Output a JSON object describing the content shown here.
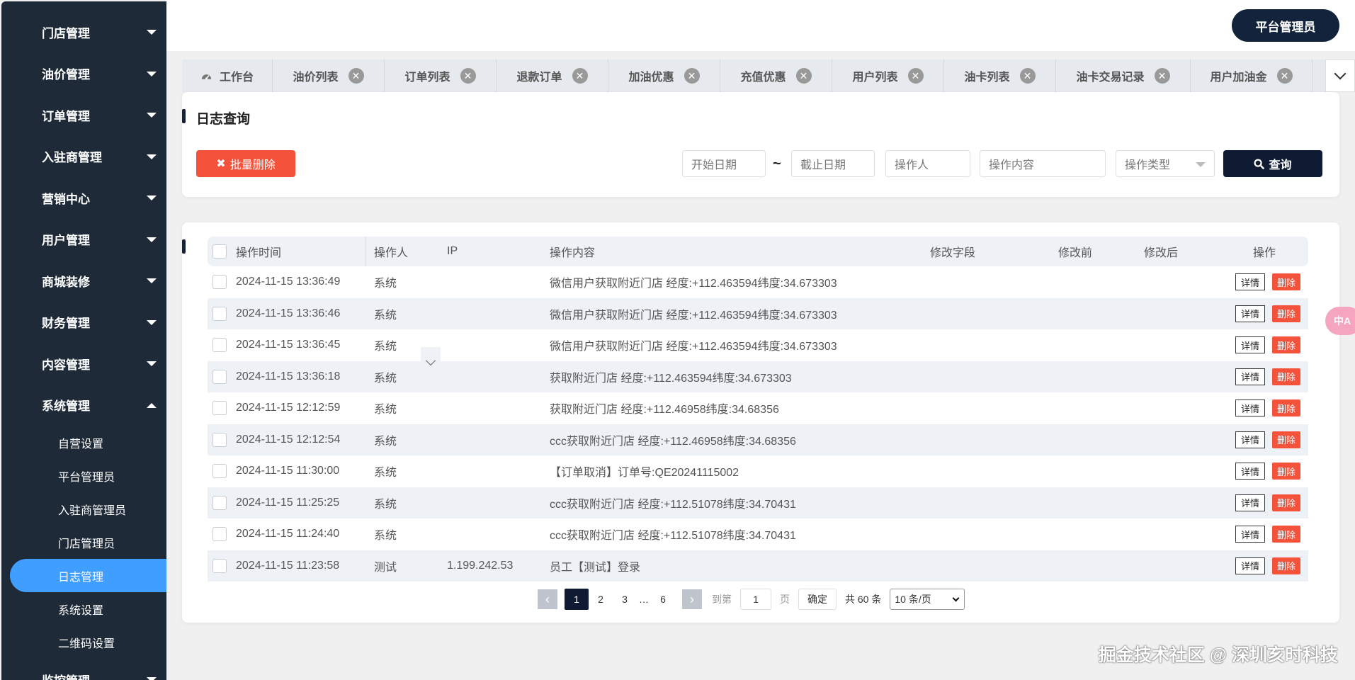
{
  "sidebar": {
    "menus": [
      {
        "label": "门店管理"
      },
      {
        "label": "油价管理"
      },
      {
        "label": "订单管理"
      },
      {
        "label": "入驻商管理"
      },
      {
        "label": "营销中心"
      },
      {
        "label": "用户管理"
      },
      {
        "label": "商城装修"
      },
      {
        "label": "财务管理"
      },
      {
        "label": "内容管理"
      },
      {
        "label": "系统管理"
      }
    ],
    "sub_items": [
      {
        "label": "自营设置"
      },
      {
        "label": "平台管理员"
      },
      {
        "label": "入驻商管理员"
      },
      {
        "label": "门店管理员"
      },
      {
        "label": "日志管理"
      },
      {
        "label": "系统设置"
      },
      {
        "label": "二维码设置"
      }
    ],
    "last_menu": "监控管理",
    "active_color": "#409eff"
  },
  "header": {
    "admin_label": "平台管理员"
  },
  "tabs": [
    {
      "label": "工作台"
    },
    {
      "label": "油价列表"
    },
    {
      "label": "订单列表"
    },
    {
      "label": "退款订单"
    },
    {
      "label": "加油优惠"
    },
    {
      "label": "充值优惠"
    },
    {
      "label": "用户列表"
    },
    {
      "label": "油卡列表"
    },
    {
      "label": "油卡交易记录"
    },
    {
      "label": "用户加油金"
    }
  ],
  "search": {
    "title": "日志查询",
    "batch_delete": "批量删除",
    "start_date": "开始日期",
    "tilde": "~",
    "end_date": "截止日期",
    "operator": "操作人",
    "content": "操作内容",
    "type": "操作类型",
    "query": "查询"
  },
  "table": {
    "headers": {
      "time": "操作时间",
      "operator": "操作人",
      "ip": "IP",
      "content": "操作内容",
      "field": "修改字段",
      "before": "修改前",
      "after": "修改后",
      "action": "操作"
    },
    "detail_label": "详情",
    "delete_label": "删除",
    "rows": [
      {
        "time": "2024-11-15 13:36:49",
        "operator": "系统",
        "ip": "",
        "content": "微信用户获取附近门店 经度:+112.463594纬度:34.673303"
      },
      {
        "time": "2024-11-15 13:36:46",
        "operator": "系统",
        "ip": "",
        "content": "微信用户获取附近门店 经度:+112.463594纬度:34.673303"
      },
      {
        "time": "2024-11-15 13:36:45",
        "operator": "系统",
        "ip": "",
        "content": "微信用户获取附近门店 经度:+112.463594纬度:34.673303"
      },
      {
        "time": "2024-11-15 13:36:18",
        "operator": "系统",
        "ip": "",
        "content": "获取附近门店 经度:+112.463594纬度:34.673303"
      },
      {
        "time": "2024-11-15 12:12:59",
        "operator": "系统",
        "ip": "",
        "content": "获取附近门店 经度:+112.46958纬度:34.68356"
      },
      {
        "time": "2024-11-15 12:12:54",
        "operator": "系统",
        "ip": "",
        "content": "ccc获取附近门店 经度:+112.46958纬度:34.68356"
      },
      {
        "time": "2024-11-15 11:30:00",
        "operator": "系统",
        "ip": "",
        "content": "【订单取消】订单号:QE20241115002"
      },
      {
        "time": "2024-11-15 11:25:25",
        "operator": "系统",
        "ip": "",
        "content": "ccc获取附近门店 经度:+112.51078纬度:34.70431"
      },
      {
        "time": "2024-11-15 11:24:40",
        "operator": "系统",
        "ip": "",
        "content": "ccc获取附近门店 经度:+112.51078纬度:34.70431"
      },
      {
        "time": "2024-11-15 11:23:58",
        "operator": "测试",
        "ip": "1.199.242.53",
        "content": "员工【测试】登录"
      }
    ]
  },
  "pagination": {
    "pages": [
      "1",
      "2",
      "3",
      "…",
      "6"
    ],
    "current": "1",
    "goto_label": "到第",
    "goto_value": "1",
    "page_unit": "页",
    "confirm": "确定",
    "total": "共 60 条",
    "page_size": "10 条/页"
  },
  "translate_label": "中A",
  "watermark": "掘金技术社区 @ 深圳亥时科技"
}
